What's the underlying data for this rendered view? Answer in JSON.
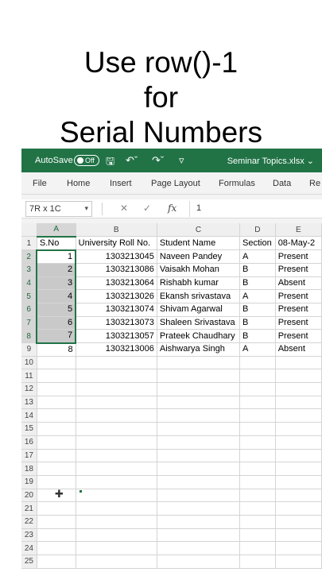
{
  "overlay": {
    "line1": "Use row()-1",
    "line2": "for",
    "line3": "Serial Numbers"
  },
  "titlebar": {
    "autosave": "AutoSave",
    "toggle": "Off",
    "document": "Seminar Topics.xlsx",
    "doc_chevron": "⌄",
    "icons": [
      "save-icon",
      "undo-icon",
      "redo-icon",
      "customize-icon"
    ]
  },
  "ribbon": {
    "tabs": [
      "File",
      "Home",
      "Insert",
      "Page Layout",
      "Formulas",
      "Data",
      "Re"
    ]
  },
  "formula_bar": {
    "name_box": "7R x 1C",
    "name_arrow": "▾",
    "cancel": "✕",
    "enter": "✓",
    "fx": "fx",
    "value": "1"
  },
  "sheet": {
    "column_headers": [
      "A",
      "B",
      "C",
      "D",
      "E"
    ],
    "row_numbers": [
      "1",
      "2",
      "3",
      "4",
      "5",
      "6",
      "7",
      "8",
      "9",
      "10",
      "11",
      "12",
      "13",
      "14",
      "15",
      "16",
      "17",
      "18",
      "19",
      "20",
      "21",
      "22",
      "23",
      "24",
      "25"
    ],
    "header_row": [
      "S.No",
      "University Roll No.",
      "Student Name",
      "Section",
      "08-May-2"
    ],
    "rows": [
      [
        "1",
        "1303213045",
        "Naveen Pandey",
        "A",
        "Present"
      ],
      [
        "2",
        "1303213086",
        "Vaisakh Mohan",
        "B",
        "Present"
      ],
      [
        "3",
        "1303213064",
        "Rishabh kumar",
        "B",
        "Absent"
      ],
      [
        "4",
        "1303213026",
        "Ekansh srivastava",
        "A",
        "Present"
      ],
      [
        "5",
        "1303213074",
        "Shivam Agarwal",
        "B",
        "Present"
      ],
      [
        "6",
        "1303213073",
        "Shaleen Srivastava",
        "B",
        "Present"
      ],
      [
        "7",
        "1303213057",
        "Prateek Chaudhary",
        "B",
        "Present"
      ],
      [
        "8",
        "1303213006",
        "Aishwarya Singh",
        "A",
        "Absent"
      ]
    ]
  },
  "colors": {
    "excel_green": "#217346",
    "selection_gray": "#c9c9c9"
  }
}
